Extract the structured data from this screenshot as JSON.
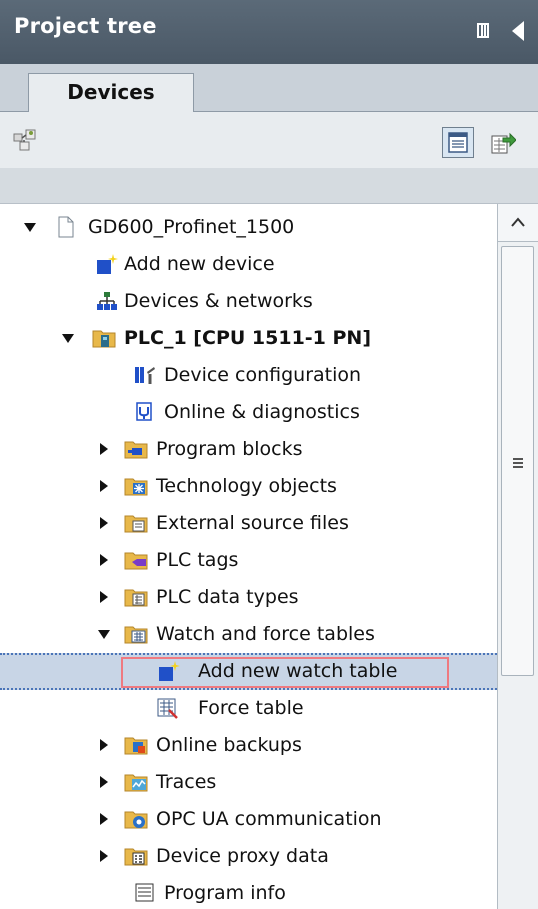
{
  "panel": {
    "title": "Project tree"
  },
  "tabs": [
    {
      "label": "Devices"
    }
  ],
  "colors": {
    "header": "#4f5e6c",
    "selection": "#c8d5e6",
    "highlight": "#ef7a80",
    "folder": "#e8b84a"
  },
  "tree": {
    "project": {
      "label": "GD600_Profinet_1500"
    },
    "add_device": {
      "label": "Add new device"
    },
    "devices_networks": {
      "label": "Devices & networks"
    },
    "plc": {
      "label": "PLC_1 [CPU 1511-1 PN]"
    },
    "device_config": {
      "label": "Device configuration"
    },
    "online_diag": {
      "label": "Online & diagnostics"
    },
    "program_blocks": {
      "label": "Program blocks"
    },
    "technology_objects": {
      "label": "Technology objects"
    },
    "external_sources": {
      "label": "External source files"
    },
    "plc_tags": {
      "label": "PLC tags"
    },
    "plc_data_types": {
      "label": "PLC data types"
    },
    "watch_force": {
      "label": "Watch and force tables"
    },
    "add_watch_table": {
      "label": "Add new watch table"
    },
    "force_table": {
      "label": "Force table"
    },
    "online_backups": {
      "label": "Online backups"
    },
    "traces": {
      "label": "Traces"
    },
    "opc_ua": {
      "label": "OPC UA communication"
    },
    "device_proxy": {
      "label": "Device proxy data"
    },
    "program_info": {
      "label": "Program info"
    }
  }
}
